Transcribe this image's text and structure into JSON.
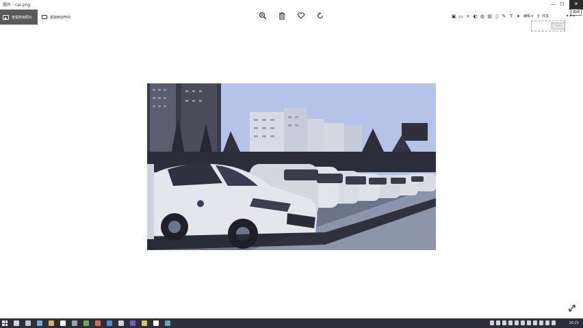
{
  "window": {
    "title": "照片 - car.png",
    "close_tooltip": "关闭",
    "minimize_glyph": "—",
    "maximize_glyph": "☐",
    "close_glyph": "✕"
  },
  "toolbar": {
    "view_all_label": "查看所有照片",
    "add_to_creation_label": "添加到创作中",
    "edit_label": "编辑",
    "share_label": "共享",
    "zoom_icon": "zoom-icon",
    "delete_icon": "trash-icon",
    "favorite_icon": "heart-icon",
    "rotate_icon": "rotate-icon"
  },
  "overlay": {
    "chip_text": "——"
  },
  "photo": {
    "description_icon": "car-photo",
    "sky_color": "#b7c5ea",
    "dark_color": "#262732"
  },
  "taskbar": {
    "clock": "20:21",
    "background": "#2e2e38"
  }
}
